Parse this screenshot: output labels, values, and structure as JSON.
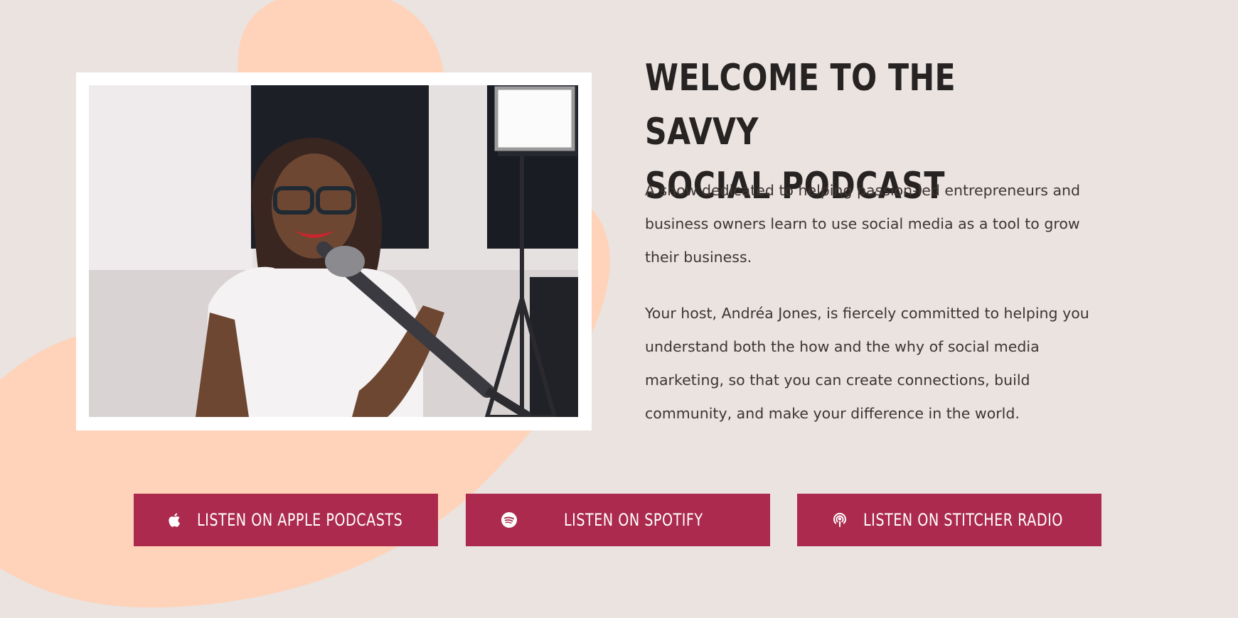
{
  "welcome": {
    "title_line1": "WELCOME TO THE SAVVY",
    "title_line2": "SOCIAL PODCAST",
    "paragraph1": "A show dedicated to helping passion-led entrepreneurs and business owners learn to use social media as a tool to grow their business.",
    "paragraph2": "Your host, Andréa Jones, is fiercely committed to helping you understand both the how and the why of social media marketing, so that you can create connections, build community, and make your difference in the world."
  },
  "buttons": {
    "apple": {
      "label": "LISTEN ON APPLE PODCASTS",
      "icon": "apple-icon"
    },
    "spotify": {
      "label": "LISTEN ON SPOTIFY",
      "icon": "spotify-icon"
    },
    "stitcher": {
      "label": "LISTEN ON STITCHER RADIO",
      "icon": "podcast-icon"
    }
  },
  "colors": {
    "background": "#eae3e0",
    "blob": "#fed3b9",
    "button": "#ab2a4d",
    "heading": "#262322",
    "body_text": "#3c3533"
  }
}
